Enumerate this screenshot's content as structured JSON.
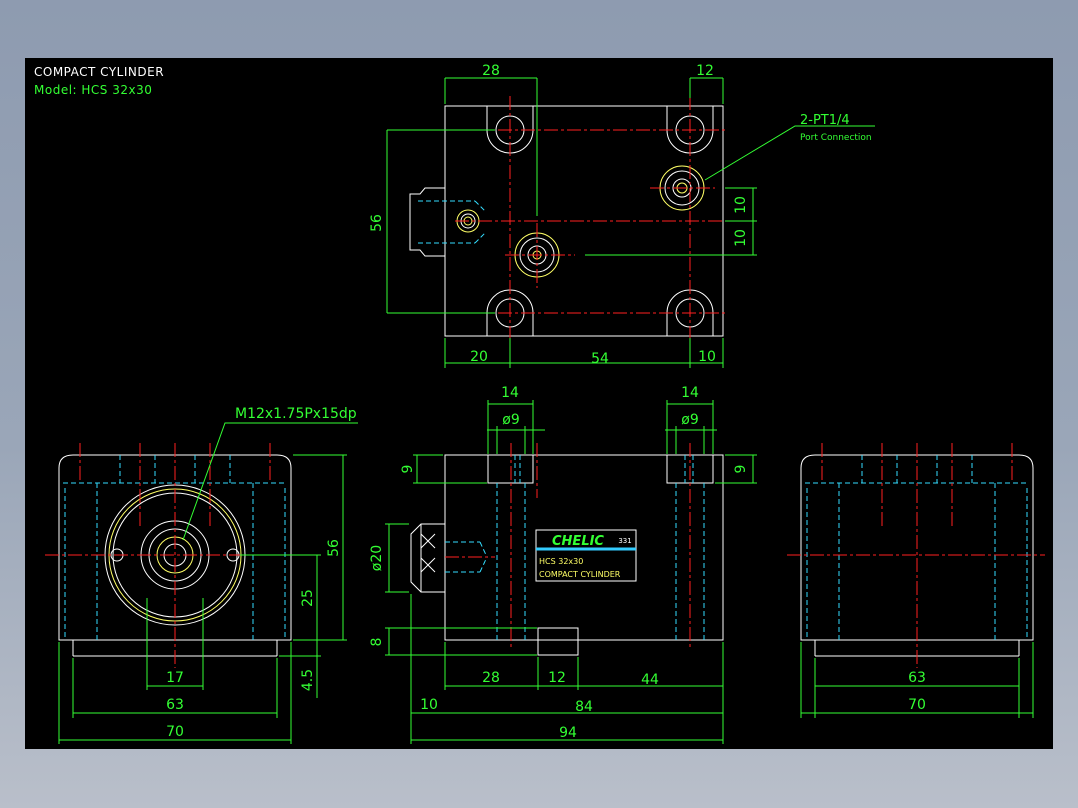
{
  "title_block": {
    "title": "COMPACT CYLINDER",
    "model": "Model: HCS 32x30"
  },
  "top_view": {
    "dim_28": "28",
    "dim_12": "12",
    "dim_56": "56",
    "dim_10a": "10",
    "dim_10b": "10",
    "dim_20": "20",
    "dim_54": "54",
    "dim_10c": "10",
    "port_label": "2-PT1/4",
    "port_sub": "Port Connection"
  },
  "left_view": {
    "thread_label": "M12x1.75Px15dp",
    "dim_56": "56",
    "dim_25": "25",
    "dim_4_5": "4.5",
    "dim_17": "17",
    "dim_63": "63",
    "dim_70": "70"
  },
  "front_view": {
    "dim_14a": "14",
    "dim_9a": "ø9",
    "dim_14b": "14",
    "dim_9b": "ø9",
    "dim_9_left": "9",
    "dim_9_right": "9",
    "dim_20": "ø20",
    "dim_8": "8",
    "dim_28": "28",
    "dim_12": "12",
    "dim_44": "44",
    "dim_10": "10",
    "dim_84": "84",
    "dim_94": "94",
    "plate_brand": "CHELIC",
    "plate_code": "331",
    "plate_model": "HCS 32x30",
    "plate_name": "COMPACT CYLINDER"
  },
  "right_view": {
    "dim_63": "63",
    "dim_70": "70"
  },
  "colors": {
    "background": "#000000",
    "outline": "#ffffff",
    "dimension": "#33ff33",
    "center_line": "#ff2020",
    "hidden_line": "#33ddff",
    "thread": "#ffff66"
  }
}
